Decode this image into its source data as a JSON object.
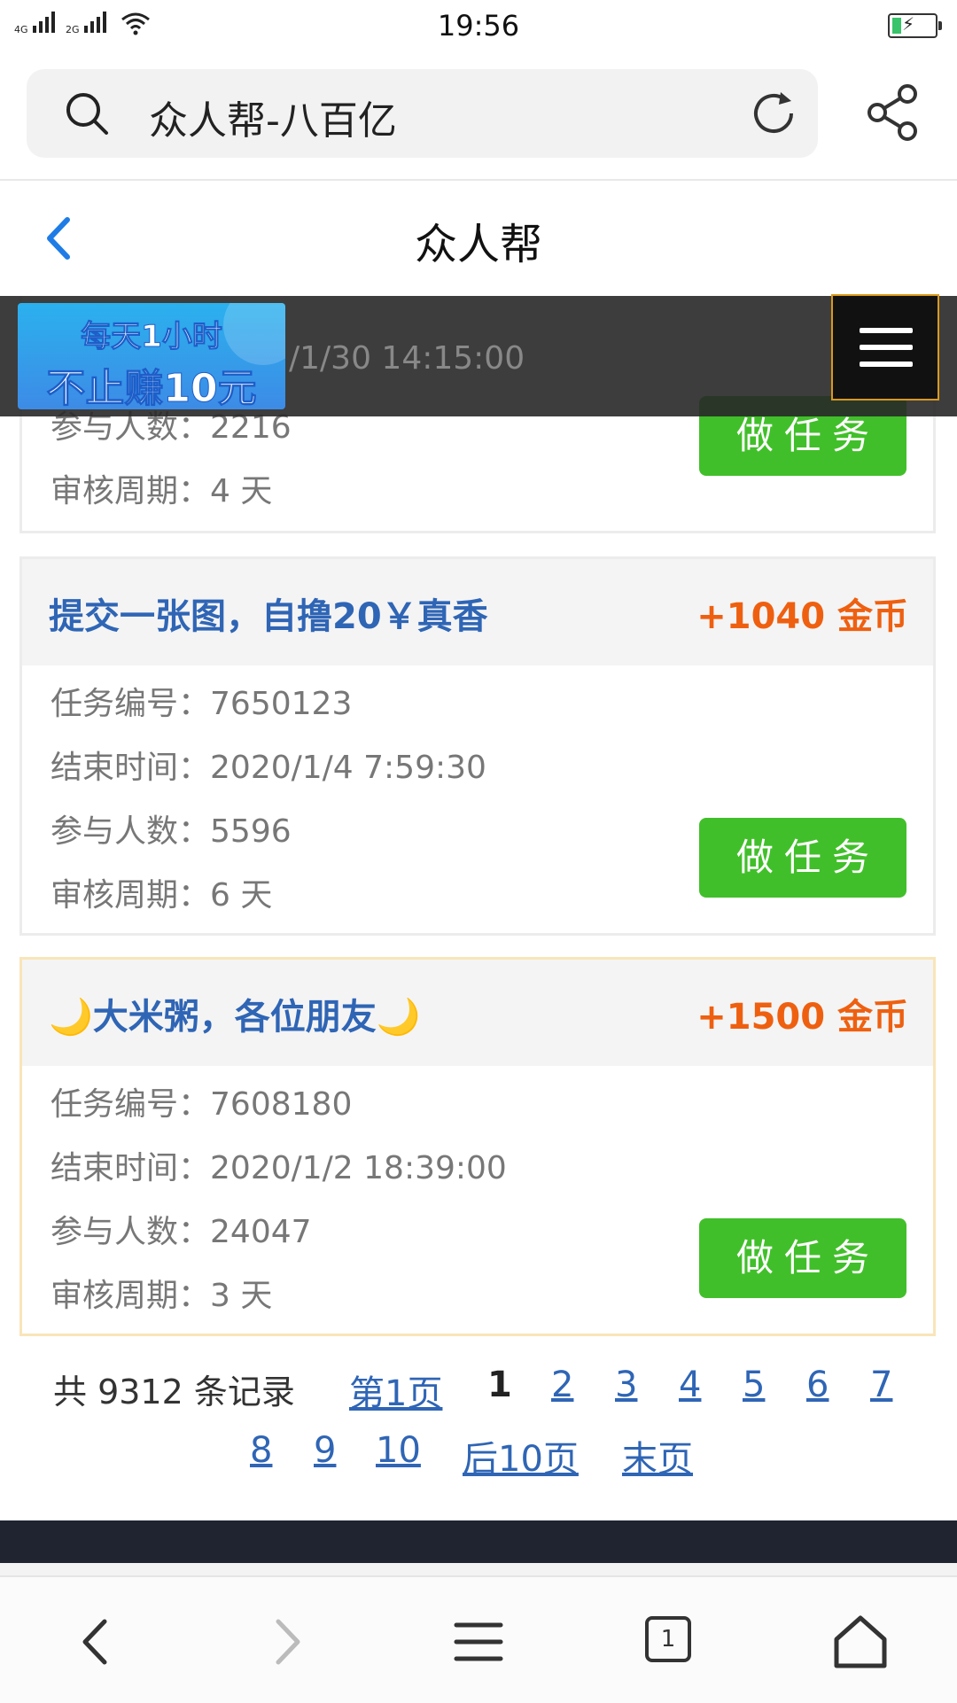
{
  "status_bar": {
    "network1": "4G",
    "network2": "2G",
    "time": "19:56"
  },
  "browser": {
    "query": "众人帮-八百亿",
    "icons": {
      "search": "search-icon",
      "reload": "reload-icon",
      "share": "share-icon"
    }
  },
  "header": {
    "title": "众人帮",
    "back_icon": "chevron-left-icon"
  },
  "overlay": {
    "ad_line1": "每天1小时",
    "ad_line2": "不止赚10元",
    "peek_text": "/1/30 14:15:00",
    "menu_icon": "hamburger-menu-icon"
  },
  "tasks": [
    {
      "participants_label": "参与人数：",
      "participants": "2216",
      "review_label": "审核周期：",
      "review": "4 天",
      "button": "做任务"
    },
    {
      "title": "提交一张图，自撸20￥真香",
      "reward": "+1040 金币",
      "id_label": "任务编号：",
      "id": "7650123",
      "end_label": "结束时间：",
      "end": "2020/1/4 7:59:30",
      "participants_label": "参与人数：",
      "participants": "5596",
      "review_label": "审核周期：",
      "review": "6 天",
      "button": "做任务"
    },
    {
      "title": "🌙大米粥，各位朋友🌙",
      "reward": "+1500 金币",
      "id_label": "任务编号：",
      "id": "7608180",
      "end_label": "结束时间：",
      "end": "2020/1/2 18:39:00",
      "participants_label": "参与人数：",
      "participants": "24047",
      "review_label": "审核周期：",
      "review": "3 天",
      "button": "做任务"
    }
  ],
  "pagination": {
    "summary": "共 9312 条记录",
    "first": "第1页",
    "current": "1",
    "pages": [
      "2",
      "3",
      "4",
      "5",
      "6",
      "7",
      "8",
      "9",
      "10"
    ],
    "next10": "后10页",
    "last": "末页"
  },
  "bottom_nav": {
    "tab_count": "1",
    "icons": [
      "back-arrow-icon",
      "forward-arrow-icon",
      "menu-icon",
      "tabs-icon",
      "home-icon"
    ]
  }
}
